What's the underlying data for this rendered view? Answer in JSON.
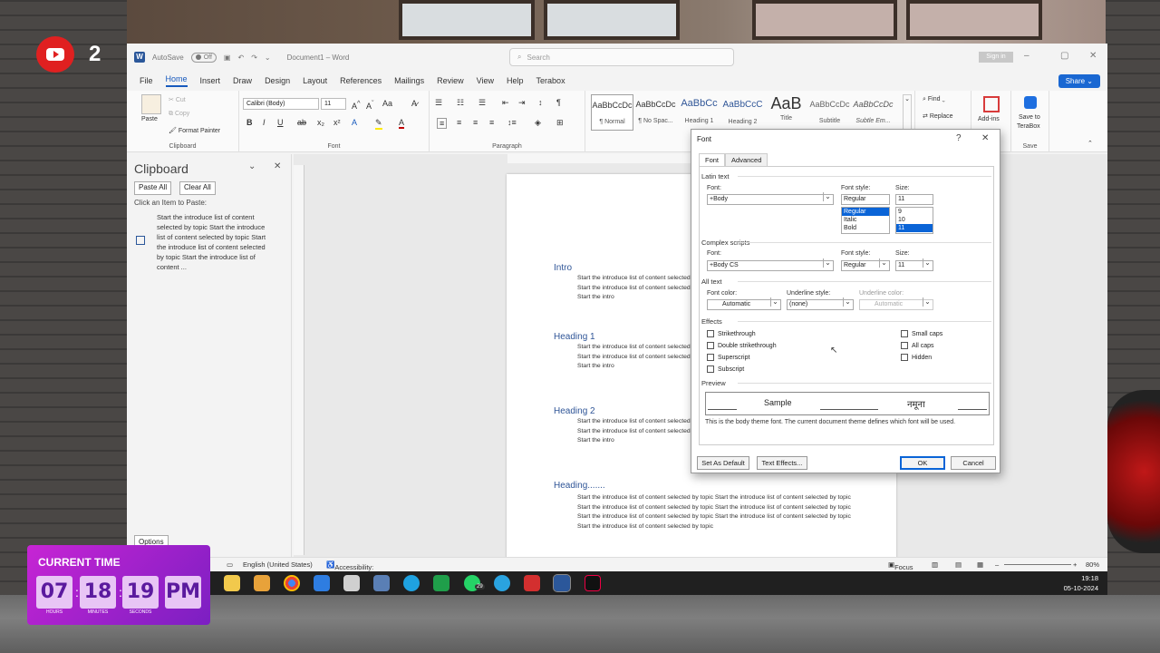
{
  "overlay": {
    "youtube_count": "2",
    "time_widget": {
      "title": "CURRENT TIME",
      "hours": "07",
      "minutes": "18",
      "seconds": "19",
      "ampm": "PM",
      "hours_caption": "HOURS",
      "minutes_caption": "MINUTES",
      "seconds_caption": "SECONDS"
    }
  },
  "titlebar": {
    "autosave_label": "AutoSave",
    "autosave_state": "Off",
    "doc_title": "Document1 – Word",
    "search_placeholder": "Search",
    "signin": "Sign in"
  },
  "menu": {
    "tabs": [
      "File",
      "Home",
      "Insert",
      "Draw",
      "Design",
      "Layout",
      "References",
      "Mailings",
      "Review",
      "View",
      "Help",
      "Terabox"
    ],
    "share": "Share"
  },
  "ribbon": {
    "clipboard": {
      "paste": "Paste",
      "cut": "Cut",
      "copy": "Copy",
      "format_painter": "Format Painter",
      "label": "Clipboard"
    },
    "font": {
      "family": "Calibri (Body)",
      "size": "11",
      "label": "Font"
    },
    "paragraph": {
      "label": "Paragraph"
    },
    "styles": [
      {
        "preview": "AaBbCcDc",
        "name": "¶ Normal"
      },
      {
        "preview": "AaBbCcDc",
        "name": "¶ No Spac..."
      },
      {
        "preview": "AaBbCc",
        "name": "Heading 1"
      },
      {
        "preview": "AaBbCcC",
        "name": "Heading 2"
      },
      {
        "preview": "AaB",
        "name": "Title"
      },
      {
        "preview": "AaBbCcDc",
        "name": "Subtitle"
      },
      {
        "preview": "AaBbCcDc",
        "name": "Subtle Em..."
      }
    ],
    "editing": {
      "find": "Find",
      "replace": "Replace"
    },
    "addins": "Add-ins",
    "save_terabox_line1": "Save to",
    "save_terabox_line2": "TeraBox",
    "save_label": "Save"
  },
  "clipboard_pane": {
    "title": "Clipboard",
    "paste_all": "Paste All",
    "clear_all": "Clear All",
    "hint": "Click an Item to Paste:",
    "item_text": "Start the introduce list of content selected by topic Start the introduce list of content selected by topic Start the introduce list of content selected by topic Start the introduce list of content ...",
    "options": "Options"
  },
  "document": {
    "sections": [
      {
        "heading": "Intro",
        "text": "Start the introduce list of content selected by topic Start the introduce list of content selected by topic Start the introduce list of content selected by topic Start the introduce list of content selected by topic Start the intro"
      },
      {
        "heading": "Heading 1",
        "text": "Start the introduce list of content selected by topic Start the introduce list of content selected by topic Start the introduce list of content selected by topic Start the introduce list of content selected by topic Start the intro"
      },
      {
        "heading": "Heading 2",
        "text": "Start the introduce list of content selected by topic Start the introduce list of content selected by topic Start the introduce list of content selected by topic Start the introduce list of content selected by topic Start the intro"
      },
      {
        "heading": "Heading.......",
        "text": "Start the introduce list of content selected by topic Start the introduce list of content selected by topic Start the introduce list of content selected by topic Start the introduce list of content selected by topic Start the introduce list of content selected by topic Start the introduce list of content selected by topic Start the introduce list of content selected by topic"
      }
    ]
  },
  "font_dialog": {
    "title": "Font",
    "help": "?",
    "close": "✕",
    "tabs": [
      "Font",
      "Advanced"
    ],
    "latin_section": "Latin text",
    "font_label": "Font:",
    "font_value": "+Body",
    "style_label": "Font style:",
    "style_value": "Regular",
    "style_options": [
      "Regular",
      "Italic",
      "Bold"
    ],
    "size_label": "Size:",
    "size_value": "11",
    "size_options": [
      "9",
      "10",
      "11"
    ],
    "complex_section": "Complex scripts",
    "cs_font_value": "+Body CS",
    "cs_style_value": "Regular",
    "cs_size_value": "11",
    "all_text_section": "All text",
    "font_color_label": "Font color:",
    "font_color_value": "Automatic",
    "underline_style_label": "Underline style:",
    "underline_style_value": "(none)",
    "underline_color_label": "Underline color:",
    "underline_color_value": "Automatic",
    "effects_section": "Effects",
    "effects_left": [
      "Strikethrough",
      "Double strikethrough",
      "Superscript",
      "Subscript"
    ],
    "effects_right": [
      "Small caps",
      "All caps",
      "Hidden"
    ],
    "preview_section": "Preview",
    "preview_sample": "Sample",
    "preview_hindi": "नमूना",
    "preview_note": "This is the body theme font. The current document theme defines which font will be used.",
    "set_default": "Set As Default",
    "text_effects": "Text Effects...",
    "ok": "OK",
    "cancel": "Cancel"
  },
  "statusbar": {
    "language": "English (United States)",
    "accessibility": "Accessibility: Good to go",
    "focus": "Focus",
    "zoom": "80%"
  },
  "taskbar": {
    "time": "19:18",
    "date": "05-10-2024",
    "whatsapp_badge": "29"
  },
  "colors": {
    "accent": "#185abd",
    "heading": "#2f5597",
    "selection": "#0a64d7",
    "widget_purple": "#9b22cc"
  }
}
